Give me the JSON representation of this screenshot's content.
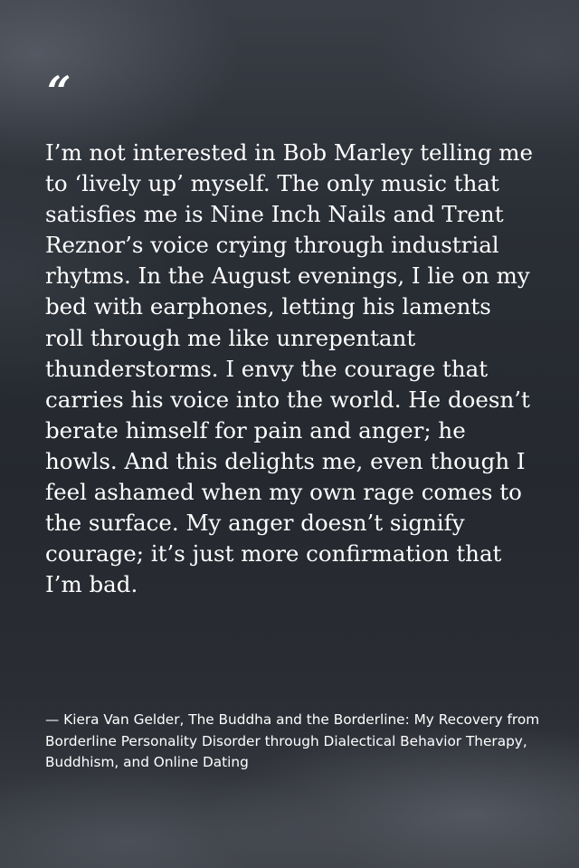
{
  "quote": {
    "mark": "“",
    "text": "I’m not interested in Bob Marley telling me to ‘lively up’ myself. The only music that satisfies me is Nine Inch Nails and Trent Reznor’s voice crying through industrial rhytms. In the August evenings, I lie on my bed with earphones, letting his laments roll through me like unrepentant thunderstorms. I envy the courage that carries his voice into the world. He doesn’t berate himself for pain and anger; he howls. And this delights me, even though I feel ashamed when my own rage comes to the surface. My anger doesn’t signify courage; it’s just more confirmation that I’m bad.",
    "attribution": "— Kiera Van Gelder, The Buddha and the Borderline: My Recovery from Borderline Personality Disorder through Dialectical Behavior Therapy, Buddhism, and Online Dating"
  },
  "colors": {
    "text": "#ffffff",
    "background": "#2c3038"
  }
}
